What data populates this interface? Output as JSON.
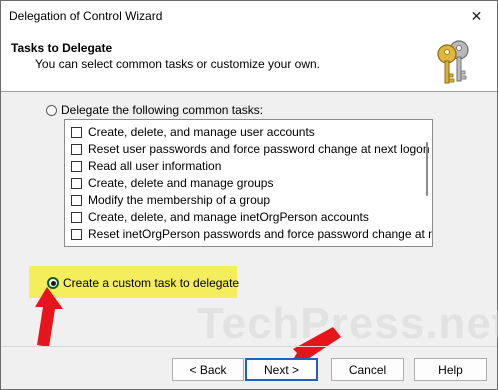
{
  "window": {
    "title": "Delegation of Control Wizard",
    "close_glyph": "✕"
  },
  "header": {
    "title": "Tasks to Delegate",
    "subtitle": "You can select common tasks or customize your own.",
    "icon": "keys-icon"
  },
  "options": {
    "common_label": "Delegate the following common tasks:",
    "common_selected": false,
    "custom_label": "Create a custom task to delegate",
    "custom_selected": true
  },
  "tasks": [
    {
      "label": "Create, delete, and manage user accounts",
      "checked": false
    },
    {
      "label": "Reset user passwords and force password change at next logon",
      "checked": false
    },
    {
      "label": "Read all user information",
      "checked": false
    },
    {
      "label": "Create, delete and manage groups",
      "checked": false
    },
    {
      "label": "Modify the membership of a group",
      "checked": false
    },
    {
      "label": "Create, delete, and manage inetOrgPerson accounts",
      "checked": false
    },
    {
      "label": "Reset inetOrgPerson passwords and force password change at next lo",
      "checked": false
    }
  ],
  "buttons": {
    "back": "< Back",
    "next": "Next >",
    "cancel": "Cancel",
    "help": "Help"
  },
  "watermark": "TechPress.net",
  "colors": {
    "highlight": "#f4ee5c",
    "annotation_arrow": "#e8141c",
    "default_button_border": "#1a63c4"
  }
}
